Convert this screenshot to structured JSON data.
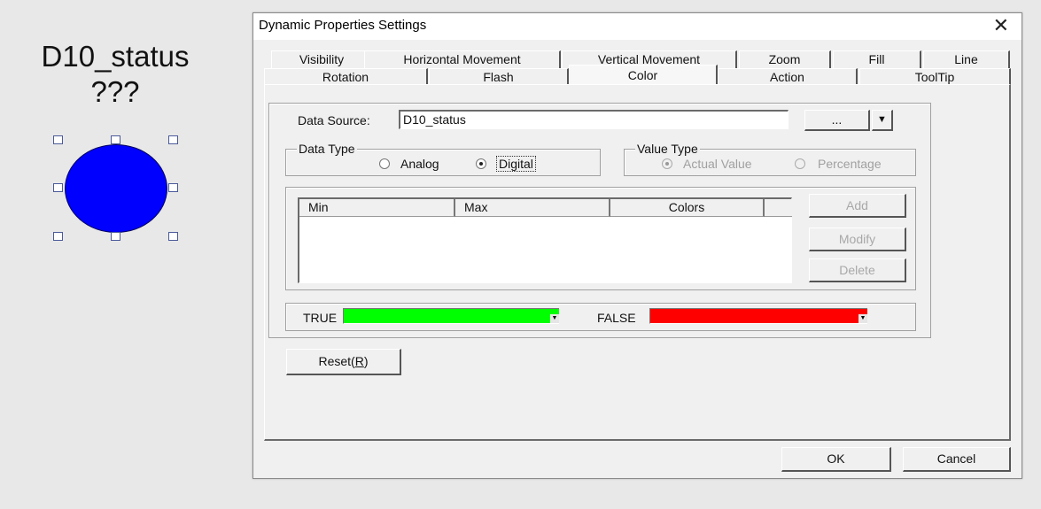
{
  "canvas_object": {
    "tag_name": "D10_status",
    "value_text": "???",
    "fill_color": "#0000ff"
  },
  "dialog": {
    "title": "Dynamic Properties Settings",
    "close_glyph": "✕",
    "tabs_row1": [
      "Visibility",
      "Horizontal Movement",
      "Vertical Movement",
      "Zoom",
      "Fill",
      "Line"
    ],
    "tabs_row2": [
      "Rotation",
      "Flash",
      "Color",
      "Action",
      "ToolTip"
    ],
    "active_tab": "Color",
    "data_source": {
      "label": "Data Source:",
      "value": "D10_status",
      "browse_label": "...",
      "dropdown_glyph": "▼"
    },
    "data_type": {
      "label": "Data Type",
      "options": [
        "Analog",
        "Digital"
      ],
      "selected": "Digital"
    },
    "value_type": {
      "label": "Value Type",
      "options": [
        "Actual Value",
        "Percentage"
      ],
      "selected": "Actual Value",
      "enabled": false
    },
    "range_table": {
      "columns": [
        "Min",
        "Max",
        "Colors"
      ],
      "rows": []
    },
    "range_buttons": {
      "add": "Add",
      "modify": "Modify",
      "delete": "Delete"
    },
    "digital_colors": {
      "true_label": "TRUE",
      "true_color": "#00ff00",
      "false_label": "FALSE",
      "false_color": "#ff0000"
    },
    "reset_prefix": "Reset(",
    "reset_key": "R",
    "reset_suffix": ")",
    "ok_label": "OK",
    "cancel_label": "Cancel"
  }
}
